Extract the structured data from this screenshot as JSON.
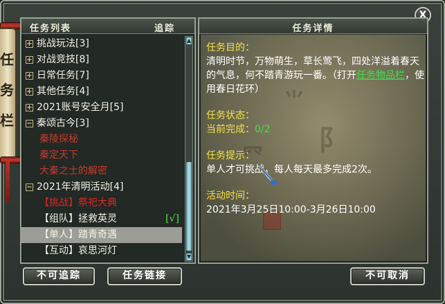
{
  "window": {
    "close_label": "X"
  },
  "deco": {
    "scroll_glyphs": [
      "任",
      "务",
      "栏"
    ]
  },
  "task_list": {
    "title": "任务列表",
    "track_label": "追踪",
    "categories": [
      {
        "label": "挑战玩法[3]",
        "expanded": false
      },
      {
        "label": "对战竞技[8]",
        "expanded": false
      },
      {
        "label": "日常任务[7]",
        "expanded": false
      },
      {
        "label": "其他任务[4]",
        "expanded": false
      },
      {
        "label": "2021账号安全月[5]",
        "expanded": false
      },
      {
        "label": "秦颂古今[3]",
        "expanded": true
      }
    ],
    "qin_subtasks": [
      "秦陵探秘",
      "秦定天下",
      "大秦之士的解密"
    ],
    "qingming": {
      "label": "2021年清明活动[4]",
      "expanded": true,
      "subtasks": [
        {
          "tag": "【挑战】",
          "name": "祭祀大典",
          "color": "red"
        },
        {
          "tag": "【组队】",
          "name": "拯救英灵",
          "done": "[√]"
        },
        {
          "tag": "【单人】",
          "name": "踏青奇遇",
          "selected": true
        },
        {
          "tag": "【互动】",
          "name": "哀思河灯"
        }
      ]
    },
    "toggle_plus": "+",
    "toggle_minus": "−"
  },
  "task_detail": {
    "title": "任务详情",
    "goal_label": "任务目的：",
    "goal_text_1": "清明时节，万物萌生，草长莺飞，四处洋溢着春天的气息，何不踏青游玩一番。（打开",
    "goal_link": "任务物品栏",
    "goal_text_2": "，使用春日花环）",
    "status_label": "任务状态：",
    "status_prefix": "当前完成：",
    "status_value": "0/2",
    "hint_label": "任务提示：",
    "hint_text": "单人才可挑战，每人每天最多完成2次。",
    "time_label": "活动时间：",
    "time_text": "2021年3月25日10:00-3月26日10:00"
  },
  "buttons": {
    "untrack": "不可追踪",
    "task_link": "任务链接",
    "cancel": "不可取消"
  },
  "colors": {
    "label_yellow": "#f2e04a",
    "link_green": "#3fe048",
    "red_task": "#c53a2a",
    "selected_row": "#9b9d96"
  }
}
